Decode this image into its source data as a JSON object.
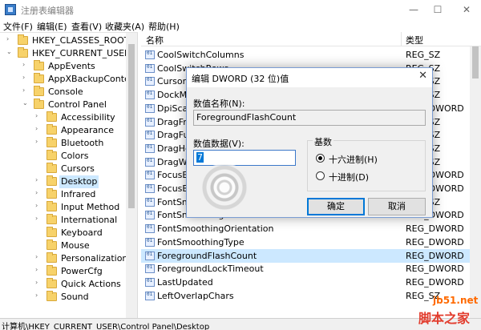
{
  "window": {
    "title": "注册表编辑器",
    "min": "—",
    "max": "☐",
    "close": "✕"
  },
  "menu": [
    "文件(F)",
    "编辑(E)",
    "查看(V)",
    "收藏夹(A)",
    "帮助(H)"
  ],
  "tree": [
    {
      "label": "HKEY_CLASSES_ROOT",
      "level": 1,
      "arrow": "›"
    },
    {
      "label": "HKEY_CURRENT_USER",
      "level": 1,
      "arrow": "⌄"
    },
    {
      "label": "AppEvents",
      "level": 2,
      "arrow": "›"
    },
    {
      "label": "AppXBackupConter",
      "level": 2,
      "arrow": "›"
    },
    {
      "label": "Console",
      "level": 2,
      "arrow": "›"
    },
    {
      "label": "Control Panel",
      "level": 2,
      "arrow": "⌄"
    },
    {
      "label": "Accessibility",
      "level": 3,
      "arrow": "›"
    },
    {
      "label": "Appearance",
      "level": 3,
      "arrow": "›"
    },
    {
      "label": "Bluetooth",
      "level": 3,
      "arrow": "›"
    },
    {
      "label": "Colors",
      "level": 3,
      "arrow": ""
    },
    {
      "label": "Cursors",
      "level": 3,
      "arrow": ""
    },
    {
      "label": "Desktop",
      "level": 3,
      "arrow": "›",
      "selected": true
    },
    {
      "label": "Infrared",
      "level": 3,
      "arrow": "›"
    },
    {
      "label": "Input Method",
      "level": 3,
      "arrow": "›"
    },
    {
      "label": "International",
      "level": 3,
      "arrow": "›"
    },
    {
      "label": "Keyboard",
      "level": 3,
      "arrow": ""
    },
    {
      "label": "Mouse",
      "level": 3,
      "arrow": ""
    },
    {
      "label": "Personalization",
      "level": 3,
      "arrow": "›"
    },
    {
      "label": "PowerCfg",
      "level": 3,
      "arrow": "›"
    },
    {
      "label": "Quick Actions",
      "level": 3,
      "arrow": "›"
    },
    {
      "label": "Sound",
      "level": 3,
      "arrow": "›"
    }
  ],
  "list": {
    "col_name": "名称",
    "col_type": "类型",
    "rows": [
      {
        "name": "CoolSwitchColumns",
        "type": "REG_SZ"
      },
      {
        "name": "CoolSwitchRows",
        "type": "REG_SZ"
      },
      {
        "name": "CursorBlinkRate",
        "type": "REG_SZ"
      },
      {
        "name": "DockMoving",
        "type": "REG_SZ"
      },
      {
        "name": "DpiScalingVer",
        "type": "REG_DWORD"
      },
      {
        "name": "DragFromMaximize",
        "type": "REG_SZ"
      },
      {
        "name": "DragFullWindows",
        "type": "REG_SZ"
      },
      {
        "name": "DragHeight",
        "type": "REG_SZ"
      },
      {
        "name": "DragWidth",
        "type": "REG_SZ"
      },
      {
        "name": "FocusBorderHeight",
        "type": "REG_DWORD"
      },
      {
        "name": "FocusBorderWidth",
        "type": "REG_DWORD"
      },
      {
        "name": "FontSmoothing",
        "type": "REG_SZ"
      },
      {
        "name": "FontSmoothingGamma",
        "type": "REG_DWORD"
      },
      {
        "name": "FontSmoothingOrientation",
        "type": "REG_DWORD"
      },
      {
        "name": "FontSmoothingType",
        "type": "REG_DWORD"
      },
      {
        "name": "ForegroundFlashCount",
        "type": "REG_DWORD",
        "selected": true
      },
      {
        "name": "ForegroundLockTimeout",
        "type": "REG_DWORD"
      },
      {
        "name": "LastUpdated",
        "type": "REG_DWORD"
      },
      {
        "name": "LeftOverlapChars",
        "type": "REG_SZ"
      }
    ]
  },
  "status": "计算机\\HKEY_CURRENT_USER\\Control Panel\\Desktop",
  "dialog": {
    "title": "编辑 DWORD (32 位)值",
    "close": "✕",
    "name_label": "数值名称(N):",
    "name_value": "ForegroundFlashCount",
    "data_label": "数值数据(V):",
    "data_value": "7",
    "base_label": "基数",
    "hex_label": "十六进制(H)",
    "dec_label": "十进制(D)",
    "ok": "确定",
    "cancel": "取消"
  },
  "watermark": {
    "url": "jb51.net",
    "name": "脚本之家"
  }
}
